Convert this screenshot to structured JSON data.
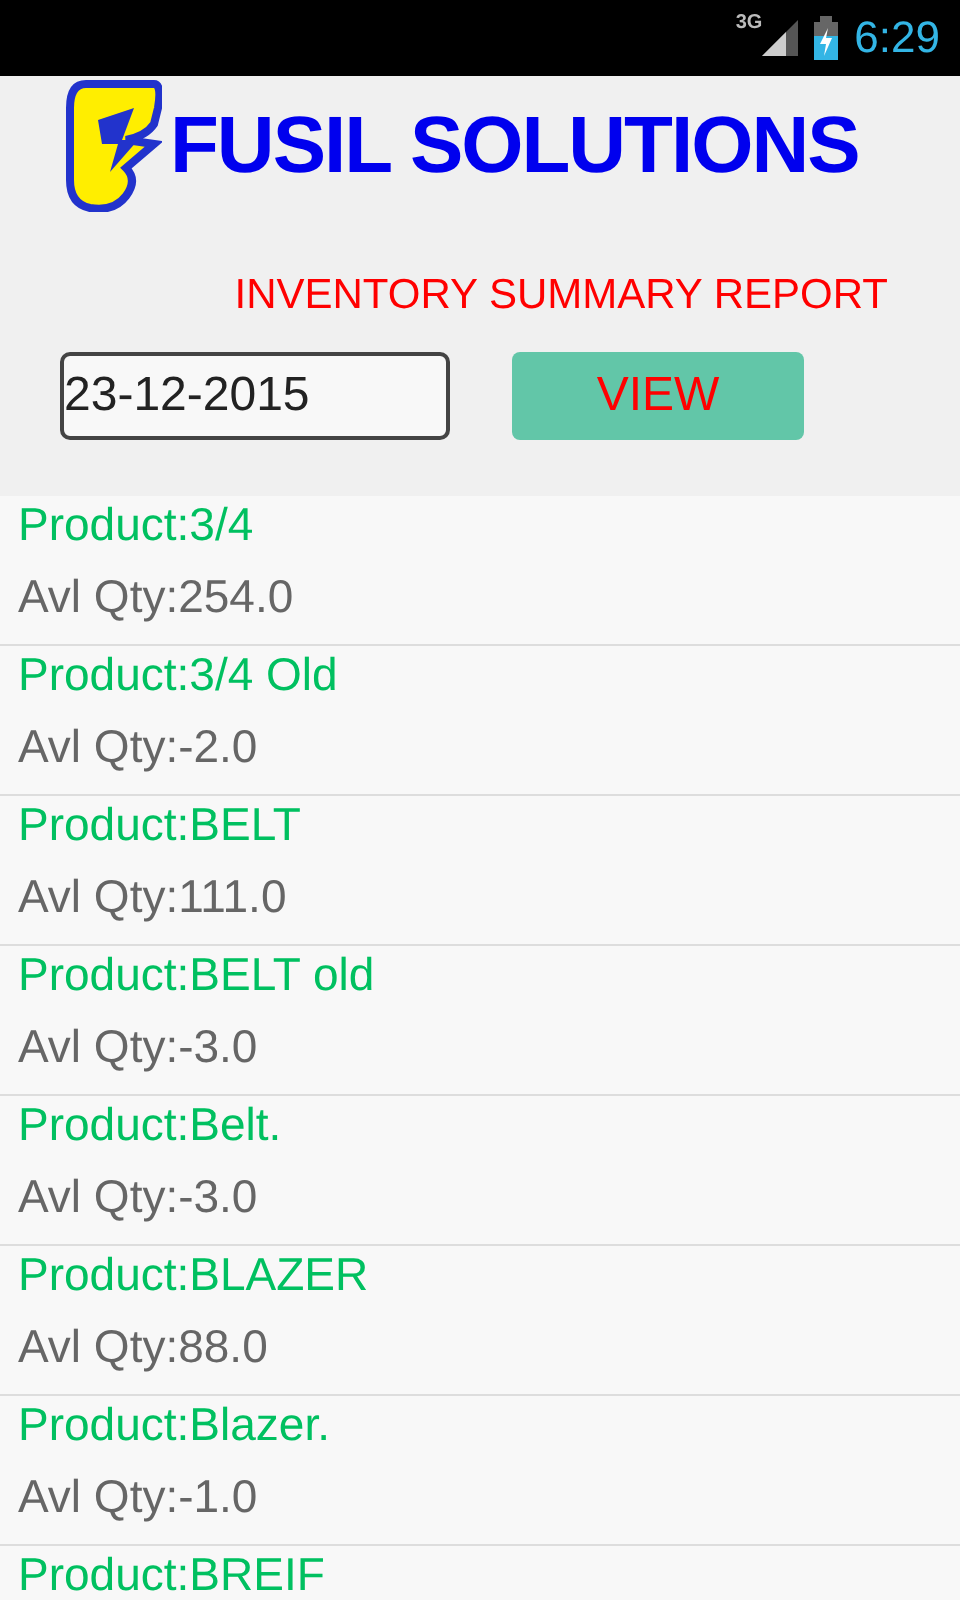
{
  "status_bar": {
    "network": "3G",
    "time": "6:29"
  },
  "header": {
    "brand": "FUSIL SOLUTIONS",
    "report_title": "INVENTORY SUMMARY REPORT"
  },
  "date_field": {
    "value": "23-12-2015"
  },
  "view_button": {
    "label": "VIEW"
  },
  "items": [
    {
      "product": "Product:3/4",
      "qty": "Avl Qty:254.0"
    },
    {
      "product": "Product:3/4 Old",
      "qty": "Avl Qty:-2.0"
    },
    {
      "product": "Product:BELT",
      "qty": "Avl Qty:111.0"
    },
    {
      "product": "Product:BELT old",
      "qty": "Avl Qty:-3.0"
    },
    {
      "product": "Product:Belt.",
      "qty": "Avl Qty:-3.0"
    },
    {
      "product": "Product:BLAZER",
      "qty": "Avl Qty:88.0"
    },
    {
      "product": "Product:Blazer.",
      "qty": "Avl Qty:-1.0"
    },
    {
      "product": "Product:BREIF"
    }
  ]
}
